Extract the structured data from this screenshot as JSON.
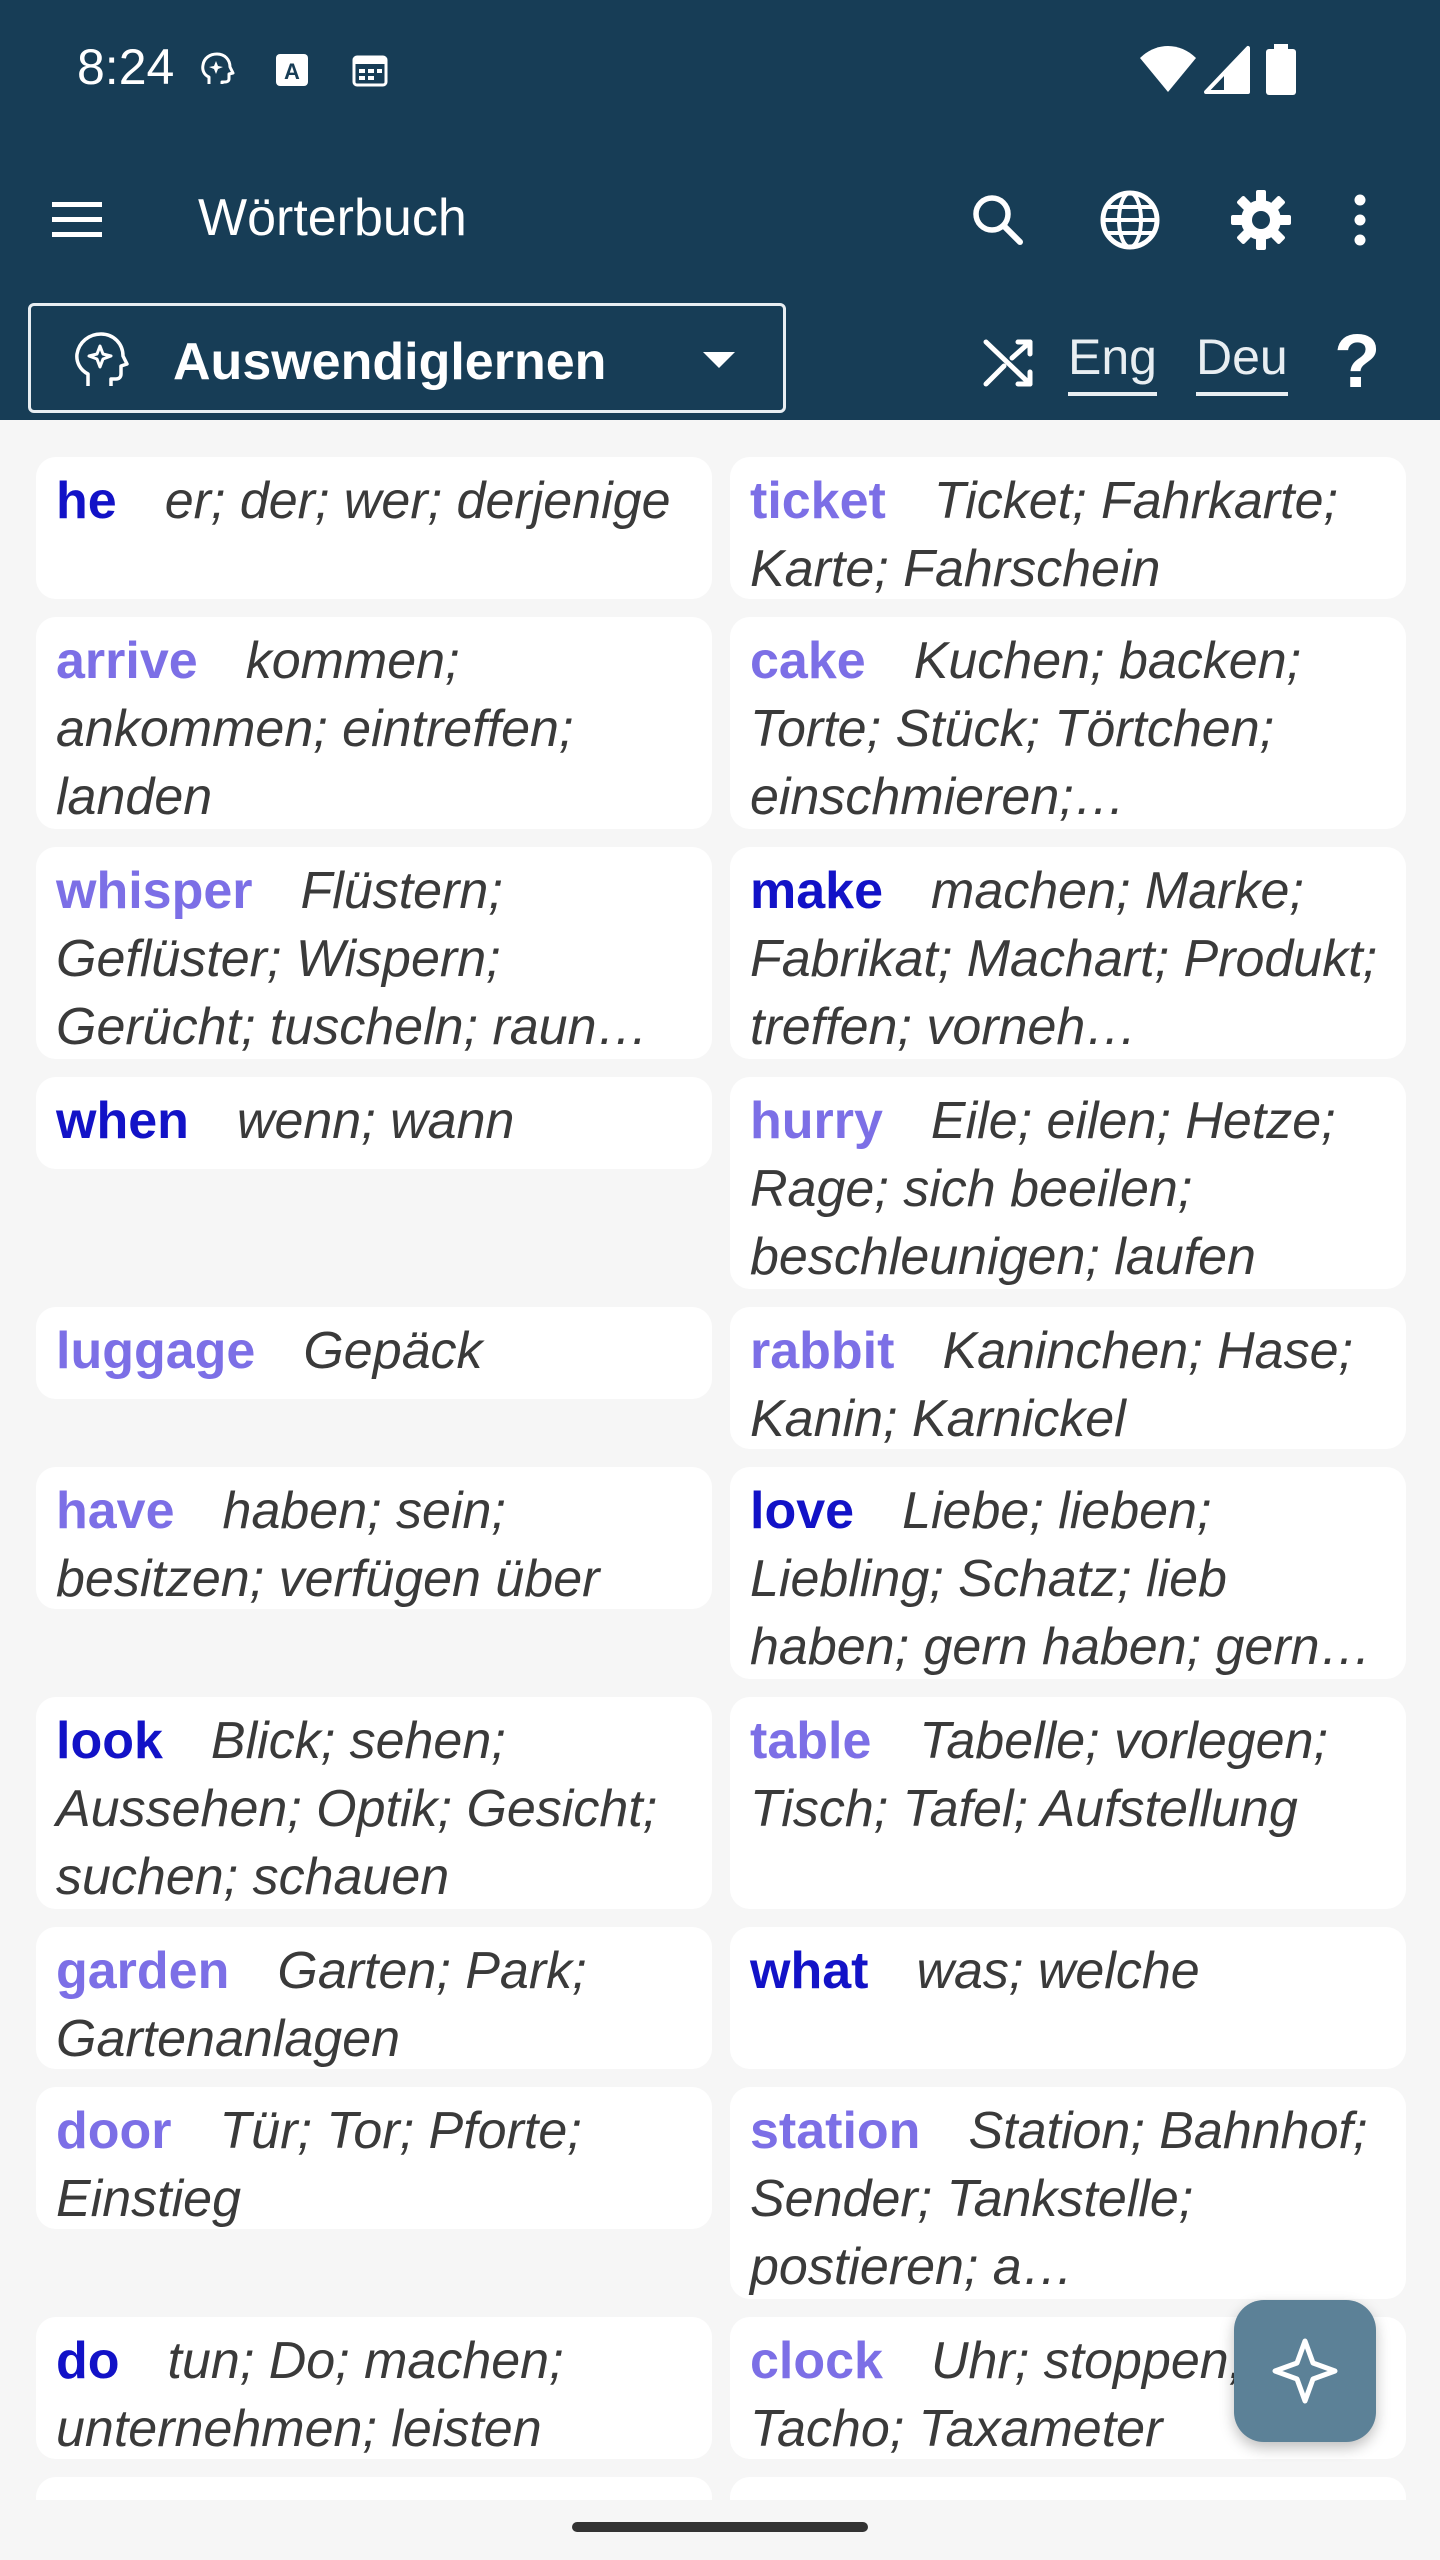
{
  "status": {
    "time": "8:24",
    "left_icons": [
      "brain-notification-icon",
      "text-a-notification-icon",
      "calendar-notification-icon"
    ],
    "right_icons": [
      "wifi-icon",
      "cellular-signal-icon",
      "battery-icon"
    ]
  },
  "appbar": {
    "title": "Wörterbuch",
    "icons": [
      "menu-icon",
      "search-icon",
      "globe-icon",
      "settings-gear-icon",
      "more-vert-icon"
    ]
  },
  "mode": {
    "selected": "Auswendiglernen",
    "lang_from": "Eng",
    "lang_to": "Deu",
    "help": "?"
  },
  "colors": {
    "header_bg": "#173d56",
    "word_active": "#1212c7",
    "word_learned": "#7c6fe6",
    "fab_bg": "#5c8197"
  },
  "cards": [
    {
      "word": "he",
      "translation": "er; der; wer; derjenige",
      "state": "active"
    },
    {
      "word": "ticket",
      "translation": "Ticket; Fahrkarte; Karte; Fahrschein",
      "state": "learned"
    },
    {
      "word": "arrive",
      "translation": "kommen; ankommen; eintreffen; landen",
      "state": "learned"
    },
    {
      "word": "cake",
      "translation": "Kuchen; backen; Torte; Stück; Törtchen; einschmieren;…",
      "state": "learned"
    },
    {
      "word": "whisper",
      "translation": "Flüstern; Geflüster; Wispern; Gerücht; tuscheln; raun…",
      "state": "learned"
    },
    {
      "word": "make",
      "translation": "machen; Marke; Fabrikat; Machart; Produkt; treffen; vorneh…",
      "state": "active"
    },
    {
      "word": "when",
      "translation": "wenn; wann",
      "state": "active"
    },
    {
      "word": "hurry",
      "translation": "Eile; eilen; Hetze; Rage; sich beeilen; beschleunigen; laufen",
      "state": "learned"
    },
    {
      "word": "luggage",
      "translation": "Gepäck",
      "state": "learned"
    },
    {
      "word": "rabbit",
      "translation": "Kaninchen; Hase; Kanin; Karnickel",
      "state": "learned"
    },
    {
      "word": "have",
      "translation": "haben; sein; besitzen; verfügen über",
      "state": "learned"
    },
    {
      "word": "love",
      "translation": "Liebe; lieben; Liebling; Schatz; lieb haben; gern haben; gern…",
      "state": "active"
    },
    {
      "word": "look",
      "translation": "Blick; sehen; Aussehen; Optik; Gesicht; suchen; schauen",
      "state": "active"
    },
    {
      "word": "table",
      "translation": "Tabelle; vorlegen; Tisch; Tafel; Aufstellung",
      "state": "learned"
    },
    {
      "word": "garden",
      "translation": "Garten; Park; Gartenanlagen",
      "state": "learned"
    },
    {
      "word": "what",
      "translation": "was; welche",
      "state": "active"
    },
    {
      "word": "door",
      "translation": "Tür; Tor; Pforte; Einstieg",
      "state": "learned"
    },
    {
      "word": "station",
      "translation": "Station; Bahnhof; Sender; Tankstelle; postieren; a…",
      "state": "learned"
    },
    {
      "word": "do",
      "translation": "tun; Do; machen; unternehmen; leisten",
      "state": "active"
    },
    {
      "word": "clock",
      "translation": "Uhr; stoppen; Tacho; Taxameter",
      "state": "learned"
    }
  ],
  "fab": {
    "icon": "sparkle-icon"
  }
}
